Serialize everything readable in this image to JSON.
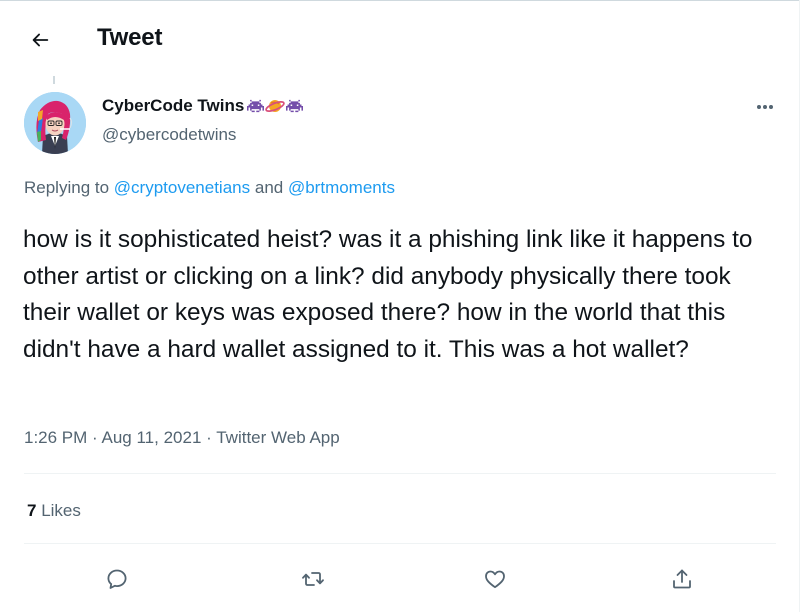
{
  "header": {
    "title": "Tweet",
    "back_icon": "arrow-left-icon"
  },
  "tweet": {
    "author": {
      "display_name": "CyberCode Twins",
      "handle": "@cybercodetwins",
      "name_emojis": [
        "alien-monster-icon",
        "ringed-planet-icon",
        "alien-monster-icon"
      ]
    },
    "replying_label": "Replying to",
    "reply_to": [
      "@cryptovenetians",
      "@brtmoments"
    ],
    "reply_joiner": "and",
    "text": "how is it sophisticated heist? was it a phishing link like it happens to other artist or clicking on a link? did anybody physically there took their wallet or keys was exposed there? how in the world that this didn't have a hard wallet assigned to it. This was a hot wallet?",
    "time": "1:26 PM",
    "date": "Aug 11, 2021",
    "separator": "·",
    "source": "Twitter Web App",
    "likes_count": "7",
    "likes_label": "Likes"
  },
  "actions": [
    "reply-icon",
    "retweet-icon",
    "like-icon",
    "share-icon"
  ],
  "colors": {
    "accent": "#1d9bf0",
    "secondary_text": "#536471",
    "primary_text": "#0f1419",
    "divider": "#eff3f4",
    "emoji_purple": "#744eaa"
  }
}
